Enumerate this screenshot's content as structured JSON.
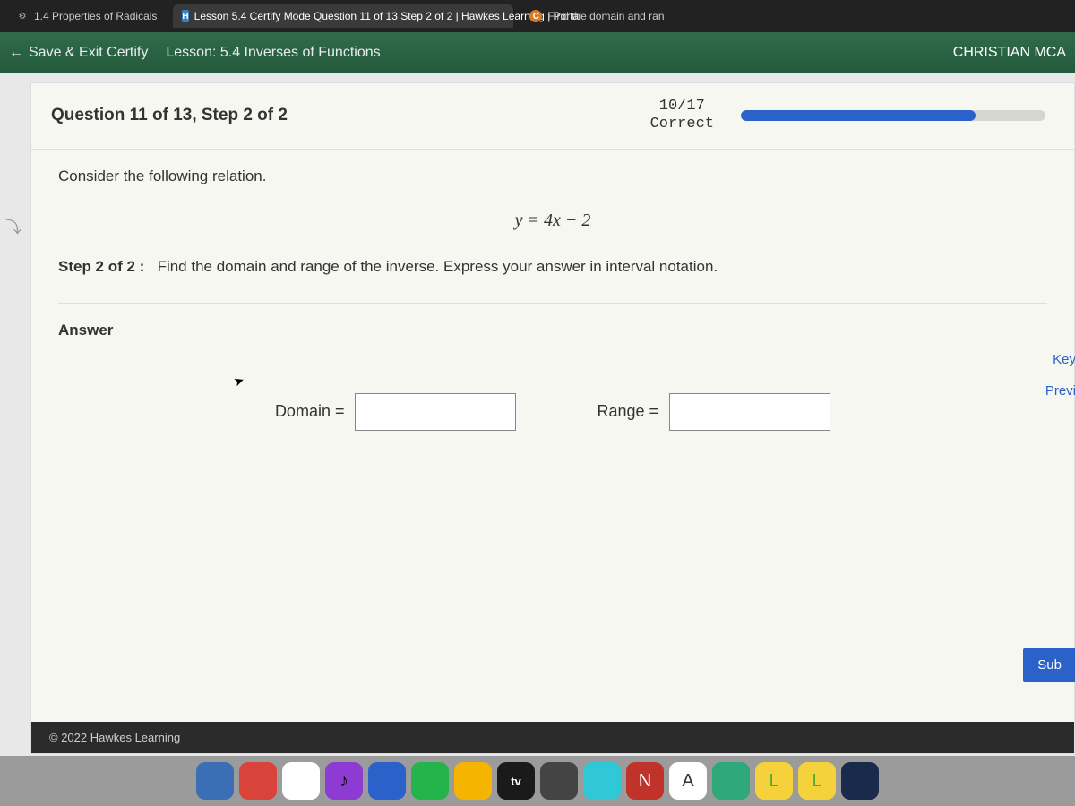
{
  "tabs": [
    {
      "icon": "gear",
      "label": "1.4 Properties of Radicals"
    },
    {
      "icon": "h",
      "label": "Lesson 5.4 Certify Mode Question 11 of 13 Step 2 of 2 | Hawkes Learning | Portal"
    },
    {
      "icon": "c",
      "label": "Find the domain and ran"
    }
  ],
  "greenbar": {
    "save_exit": "Save & Exit Certify",
    "lesson": "Lesson: 5.4 Inverses of Functions",
    "user": "CHRISTIAN MCA"
  },
  "question": {
    "title": "Question 11 of 13, Step 2 of 2",
    "score_top": "10/17",
    "score_bottom": "Correct",
    "progress_pct": 77
  },
  "body": {
    "consider": "Consider the following relation.",
    "equation": "y = 4x − 2",
    "step_prefix": "Step 2 of 2 :",
    "step_text": "Find the domain and range of the inverse. Express your answer in interval notation."
  },
  "answer": {
    "label": "Answer",
    "domain_label": "Domain =",
    "domain_value": "",
    "range_label": "Range =",
    "range_value": ""
  },
  "side": {
    "key": "Key",
    "prev": "Previ"
  },
  "buttons": {
    "submit": "Sub"
  },
  "footer": {
    "copyright": "© 2022 Hawkes Learning"
  },
  "dock": {
    "tv": "tv"
  }
}
